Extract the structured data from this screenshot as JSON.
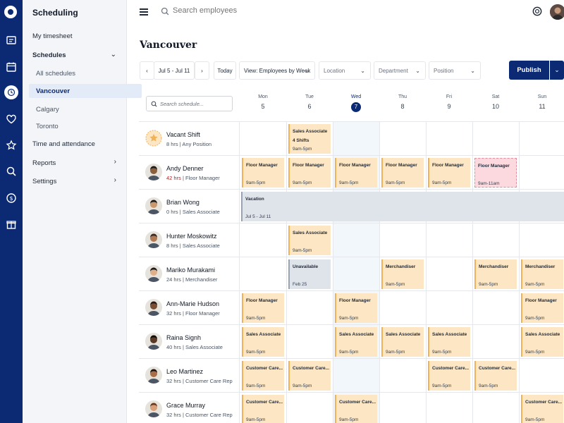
{
  "nav": {
    "title": "Scheduling",
    "my_timesheet": "My timesheet",
    "schedules": "Schedules",
    "all_schedules": "All schedules",
    "vancouver": "Vancouver",
    "calgary": "Calgary",
    "toronto": "Toronto",
    "time_attendance": "Time and attendance",
    "reports": "Reports",
    "settings": "Settings"
  },
  "header": {
    "search_placeholder": "Search employees"
  },
  "page": {
    "title": "Vancouver"
  },
  "toolbar": {
    "date_range": "Jul 5 - Jul 11",
    "today": "Today",
    "view": "View: Employees by Week",
    "location": "Location",
    "department": "Department",
    "position": "Position",
    "publish": "Publish"
  },
  "schedule": {
    "search_placeholder": "Search schedule...",
    "days": [
      {
        "name": "Mon",
        "date": "5"
      },
      {
        "name": "Tue",
        "date": "6"
      },
      {
        "name": "Wed",
        "date": "7"
      },
      {
        "name": "Thu",
        "date": "8"
      },
      {
        "name": "Fri",
        "date": "9"
      },
      {
        "name": "Sat",
        "date": "10"
      },
      {
        "name": "Sun",
        "date": "11"
      }
    ],
    "rows": [
      {
        "name": "Vacant Shift",
        "hours": "8 hrs",
        "detail": "| Any Position"
      },
      {
        "name": "Andy Denner",
        "hours": "42 hrs",
        "detail": "| Floor Manager"
      },
      {
        "name": "Brian Wong",
        "hours": "0 hrs",
        "detail": "| Sales Associate"
      },
      {
        "name": "Hunter Moskowitz",
        "hours": "8 hrs",
        "detail": "| Sales Associate"
      },
      {
        "name": "Mariko Murakami",
        "hours": "24 hrs",
        "detail": "| Merchandiser"
      },
      {
        "name": "Ann-Marie Hudson",
        "hours": "32 hrs",
        "detail": "| Floor Manager"
      },
      {
        "name": "Raina Signh",
        "hours": "40 hrs",
        "detail": "| Sales Associate"
      },
      {
        "name": "Leo Martinez",
        "hours": "32 hrs",
        "detail": "| Customer Care Rep"
      },
      {
        "name": "Grace Murray",
        "hours": "32 hrs",
        "detail": "| Customer Care Rep"
      }
    ],
    "shifts": {
      "sales_associate": "Sales Associate",
      "four_shifts": "4 Shifts",
      "floor_manager": "Floor Manager",
      "merchandiser": "Merchandiser",
      "customer_care": "Customer Care...",
      "time_9_5": "9am-5pm",
      "time_9_11": "9am-11am",
      "vacation": "Vacation",
      "vacation_range": "Jul 5 - Jul 11",
      "unavailable": "Unavailable",
      "unavailable_date": "Feb 25"
    }
  }
}
